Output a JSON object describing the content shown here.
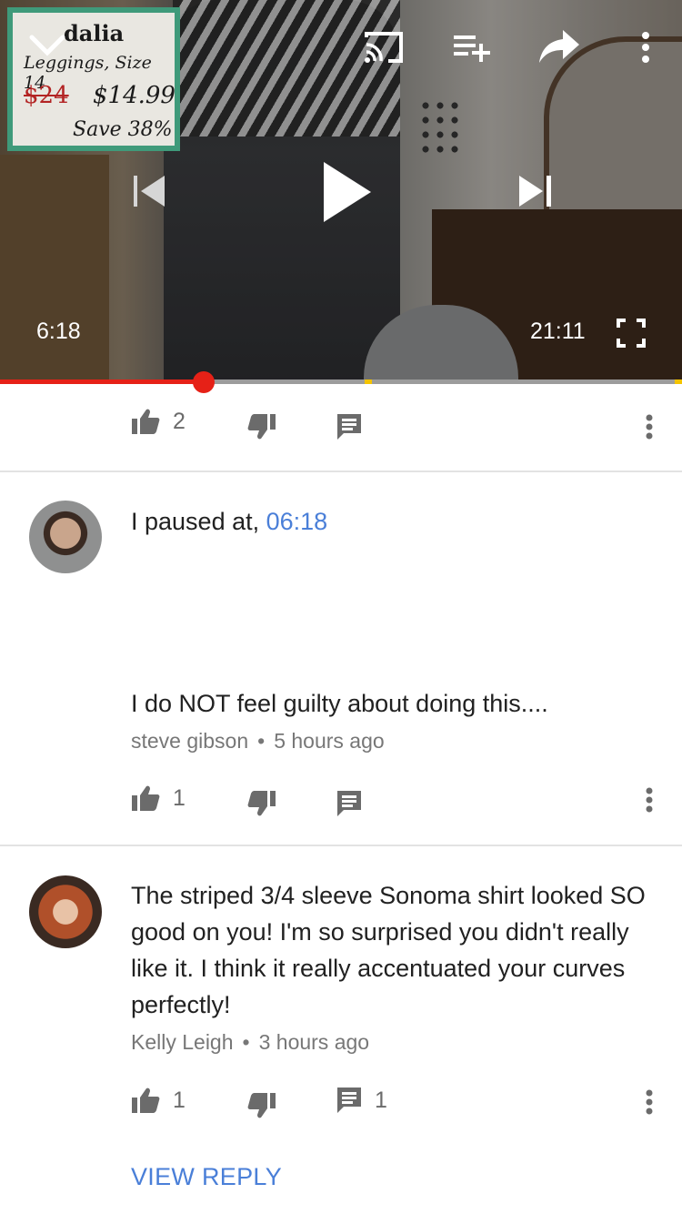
{
  "player": {
    "promo": {
      "brand": "dalia",
      "product": "Leggings, Size 14",
      "old_price": "$24",
      "new_price": "$14.99",
      "savings": "Save 38%"
    },
    "current_time": "6:18",
    "duration": "21:11",
    "progress_fraction": 0.298,
    "icons": [
      "chevron-down-icon",
      "cast-icon",
      "add-to-playlist-icon",
      "share-icon",
      "more-vert-icon",
      "skip-previous-icon",
      "play-icon",
      "skip-next-icon",
      "fullscreen-icon"
    ]
  },
  "video_actions": {
    "like_count": "2"
  },
  "comments": [
    {
      "line1_prefix": "I paused at, ",
      "line1_link": "06:18",
      "line2": "I do NOT feel guilty about doing this....",
      "author": "steve gibson",
      "dot": "•",
      "time": "5 hours ago",
      "likes": "1"
    },
    {
      "text": "The striped 3/4 sleeve Sonoma shirt looked SO good on you! I'm so surprised you didn't really like it. I think it really accentuated your curves perfectly!",
      "author": "Kelly Leigh",
      "dot": "•",
      "time": "3 hours ago",
      "likes": "1",
      "replies": "1"
    }
  ],
  "view_reply_label": "VIEW REPLY",
  "colors": {
    "accent_red": "#e62117",
    "link_blue": "#4a7fd8",
    "icon_gray": "#6b6b6b"
  }
}
